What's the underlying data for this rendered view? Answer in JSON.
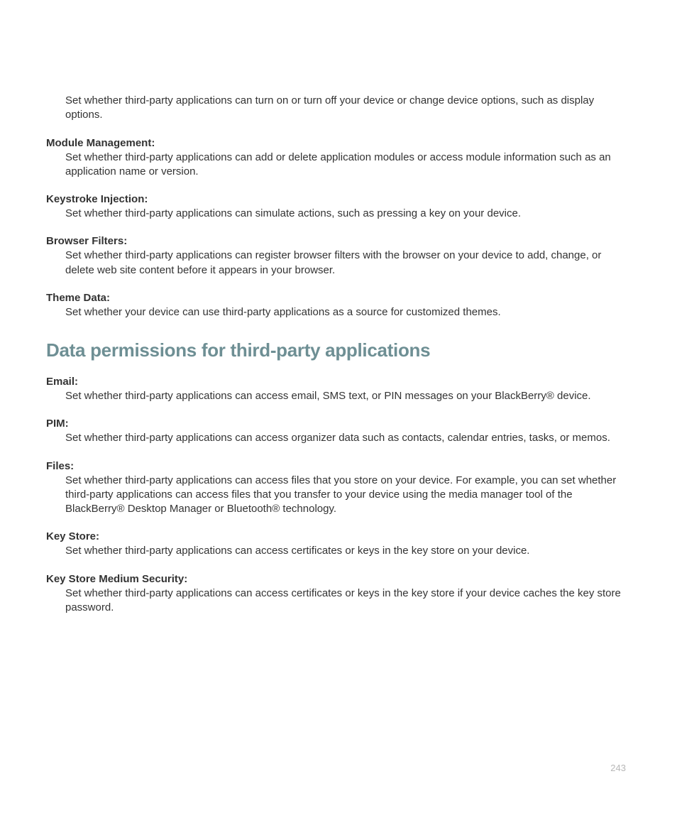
{
  "orphan_description": "Set whether third-party applications can turn on or turn off your device or change device options, such as display options.",
  "interaction_terms": [
    {
      "term": "Module Management:",
      "desc": "Set whether third-party applications can add or delete application modules or access module information such as an application name or version."
    },
    {
      "term": "Keystroke Injection:",
      "desc": "Set whether third-party applications can simulate actions, such as pressing a key on your device."
    },
    {
      "term": "Browser Filters:",
      "desc": "Set whether third-party applications can register browser filters with the browser on your device to add, change, or delete web site content before it appears in your browser."
    },
    {
      "term": "Theme Data:",
      "desc": "Set whether your device can use third-party applications as a source for customized themes."
    }
  ],
  "section_heading": "Data permissions for third-party applications",
  "data_terms": [
    {
      "term": "Email:",
      "desc": "Set whether third-party applications can access email, SMS text, or PIN messages on your BlackBerry® device."
    },
    {
      "term": "PIM:",
      "desc": "Set whether third-party applications can access organizer data such as contacts, calendar entries, tasks, or memos."
    },
    {
      "term": "Files:",
      "desc": "Set whether third-party applications can access files that you store on your device. For example, you can set whether third-party applications can access files that you transfer to your device using the media manager tool of the BlackBerry® Desktop Manager or Bluetooth® technology."
    },
    {
      "term": "Key Store:",
      "desc": "Set whether third-party applications can access certificates or keys in the key store on your device."
    },
    {
      "term": "Key Store Medium Security:",
      "desc": "Set whether third-party applications can access certificates or keys in the key store if your device caches the key store password."
    }
  ],
  "page_number": "243"
}
